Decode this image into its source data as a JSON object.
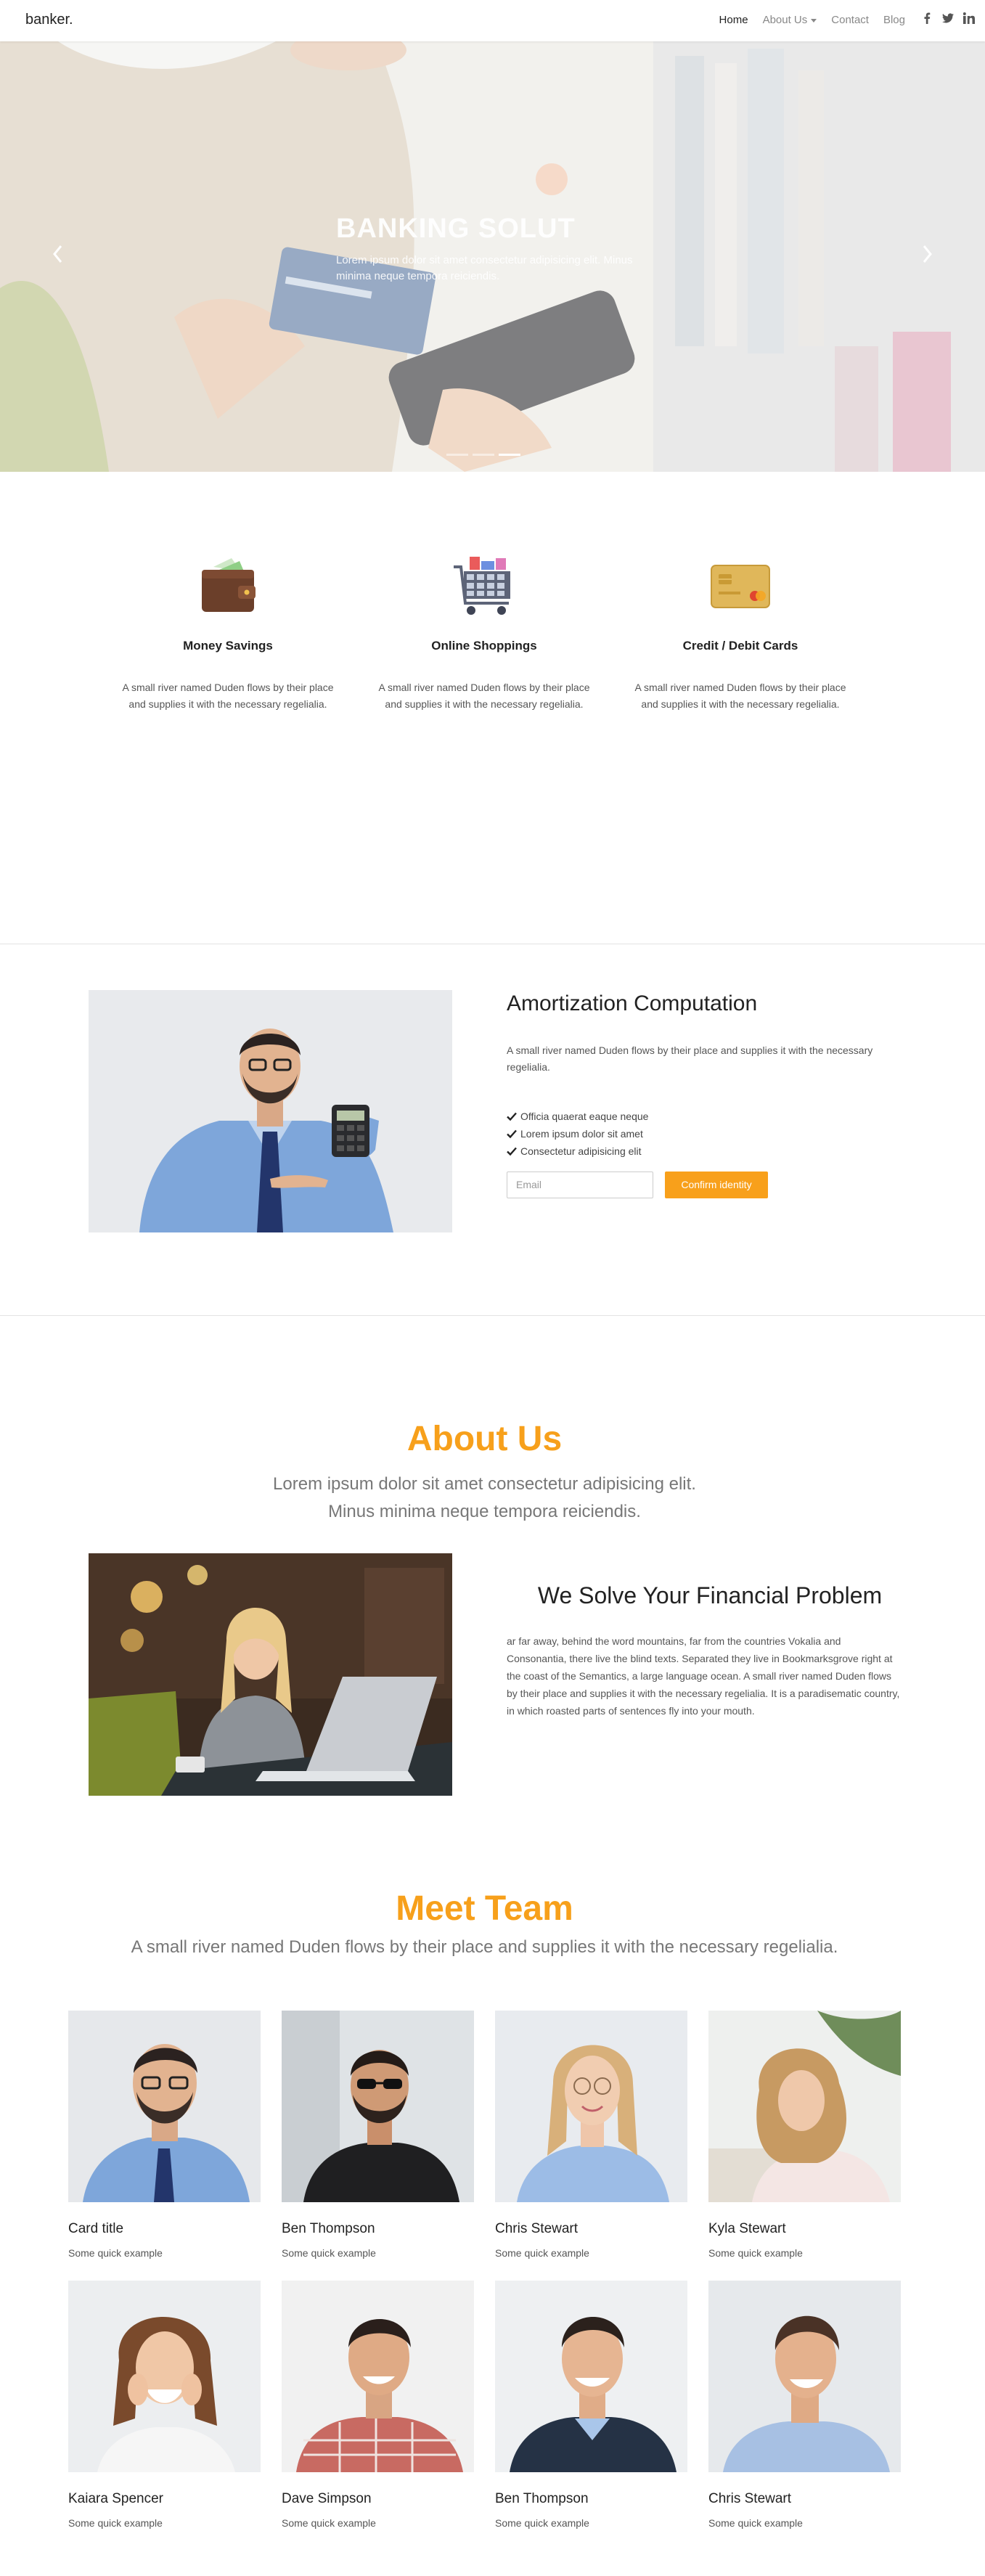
{
  "brand": "banker.",
  "nav": {
    "links": [
      {
        "label": "Home",
        "active": true
      },
      {
        "label": "About Us",
        "active": false,
        "dropdown": true
      },
      {
        "label": "Contact",
        "active": false
      },
      {
        "label": "Blog",
        "active": false
      }
    ],
    "social_icons": [
      "facebook-icon",
      "twitter-icon",
      "linkedin-icon"
    ]
  },
  "hero": {
    "title": "BANKING SOLUT",
    "subtitle": "Lorem ipsum dolor sit amet consectetur adipisicing elit. Minus minima neque tempora reiciendis.",
    "indicators": 3,
    "active_indicator": 2
  },
  "services": [
    {
      "icon": "wallet-icon",
      "title": "Money Savings",
      "text": "A small river named Duden flows by their place and supplies it with the necessary regelialia."
    },
    {
      "icon": "shopping-cart-icon",
      "title": "Online Shoppings",
      "text": "A small river named Duden flows by their place and supplies it with the necessary regelialia."
    },
    {
      "icon": "credit-card-icon",
      "title": "Credit / Debit Cards",
      "text": "A small river named Duden flows by their place and supplies it with the necessary regelialia."
    }
  ],
  "amortization": {
    "title": "Amortization Computation",
    "text": "A small river named Duden flows by their place and supplies it with the necessary regelialia.",
    "checklist": [
      "Officia quaerat eaque neque",
      "Lorem ipsum dolor sit amet",
      "Consectetur adipisicing elit"
    ],
    "email_placeholder": "Email",
    "button_label": "Confirm identity"
  },
  "about": {
    "title": "About Us",
    "subtitle_line1": "Lorem ipsum dolor sit amet consectetur adipisicing elit.",
    "subtitle_line2": "Minus minima neque tempora reiciendis.",
    "heading": "We Solve Your Financial Problem",
    "text": "ar far away, behind the word mountains, far from the countries Vokalia and Consonantia, there live the blind texts. Separated they live in Bookmarksgrove right at the coast of the Semantics, a large language ocean. A small river named Duden flows by their place and supplies it with the necessary regelialia. It is a paradisematic country, in which roasted parts of sentences fly into your mouth."
  },
  "team": {
    "title": "Meet Team",
    "subtitle": "A small river named Duden flows by their place and supplies it with the necessary regelialia.",
    "members": [
      {
        "name": "Card title",
        "desc": "Some quick example"
      },
      {
        "name": "Ben Thompson",
        "desc": "Some quick example"
      },
      {
        "name": "Chris Stewart",
        "desc": "Some quick example"
      },
      {
        "name": "Kyla Stewart",
        "desc": "Some quick example"
      },
      {
        "name": "Kaiara Spencer",
        "desc": "Some quick example"
      },
      {
        "name": "Dave Simpson",
        "desc": "Some quick example"
      },
      {
        "name": "Ben Thompson",
        "desc": "Some quick example"
      },
      {
        "name": "Chris Stewart",
        "desc": "Some quick example"
      }
    ]
  },
  "colors": {
    "accent": "#f7a01b",
    "button": "#f8a01b"
  }
}
